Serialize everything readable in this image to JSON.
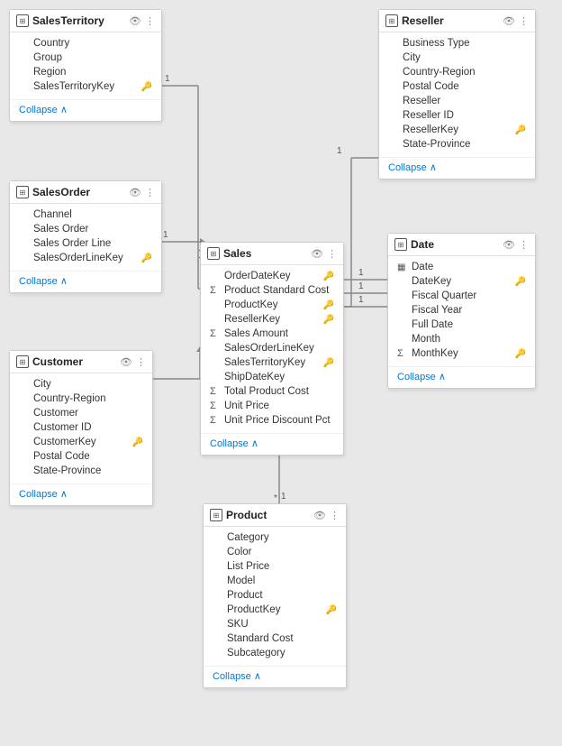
{
  "tables": {
    "salesTerritory": {
      "title": "SalesTerritory",
      "fields": [
        {
          "name": "Country",
          "prefix": "",
          "keyRight": false
        },
        {
          "name": "Group",
          "prefix": "",
          "keyRight": false
        },
        {
          "name": "Region",
          "prefix": "",
          "keyRight": false
        },
        {
          "name": "SalesTerritoryKey",
          "prefix": "",
          "keyRight": true
        }
      ],
      "collapse": "Collapse"
    },
    "reseller": {
      "title": "Reseller",
      "fields": [
        {
          "name": "Business Type",
          "prefix": "",
          "keyRight": false
        },
        {
          "name": "City",
          "prefix": "",
          "keyRight": false
        },
        {
          "name": "Country-Region",
          "prefix": "",
          "keyRight": false
        },
        {
          "name": "Postal Code",
          "prefix": "",
          "keyRight": false
        },
        {
          "name": "Reseller",
          "prefix": "",
          "keyRight": false
        },
        {
          "name": "Reseller ID",
          "prefix": "",
          "keyRight": false
        },
        {
          "name": "ResellerKey",
          "prefix": "",
          "keyRight": true
        },
        {
          "name": "State-Province",
          "prefix": "",
          "keyRight": false
        }
      ],
      "collapse": "Collapse"
    },
    "salesOrder": {
      "title": "SalesOrder",
      "fields": [
        {
          "name": "Channel",
          "prefix": "",
          "keyRight": false
        },
        {
          "name": "Sales Order",
          "prefix": "",
          "keyRight": false
        },
        {
          "name": "Sales Order Line",
          "prefix": "",
          "keyRight": false
        },
        {
          "name": "SalesOrderLineKey",
          "prefix": "",
          "keyRight": true
        }
      ],
      "collapse": "Collapse"
    },
    "sales": {
      "title": "Sales",
      "fields": [
        {
          "name": "OrderDateKey",
          "prefix": "",
          "keyRight": true
        },
        {
          "name": "Product Standard Cost",
          "prefix": "Σ",
          "keyRight": false
        },
        {
          "name": "ProductKey",
          "prefix": "",
          "keyRight": true
        },
        {
          "name": "ResellerKey",
          "prefix": "",
          "keyRight": true
        },
        {
          "name": "Sales Amount",
          "prefix": "Σ",
          "keyRight": false
        },
        {
          "name": "SalesOrderLineKey",
          "prefix": "",
          "keyRight": false
        },
        {
          "name": "SalesTerritoryKey",
          "prefix": "",
          "keyRight": true
        },
        {
          "name": "ShipDateKey",
          "prefix": "",
          "keyRight": false
        },
        {
          "name": "Total Product Cost",
          "prefix": "Σ",
          "keyRight": false
        },
        {
          "name": "Unit Price",
          "prefix": "Σ",
          "keyRight": false
        },
        {
          "name": "Unit Price Discount Pct",
          "prefix": "Σ",
          "keyRight": false
        }
      ],
      "collapse": "Collapse"
    },
    "date": {
      "title": "Date",
      "fields": [
        {
          "name": "Date",
          "prefix": "cal",
          "keyRight": false
        },
        {
          "name": "DateKey",
          "prefix": "",
          "keyRight": true
        },
        {
          "name": "Fiscal Quarter",
          "prefix": "",
          "keyRight": false
        },
        {
          "name": "Fiscal Year",
          "prefix": "",
          "keyRight": false
        },
        {
          "name": "Full Date",
          "prefix": "",
          "keyRight": false
        },
        {
          "name": "Month",
          "prefix": "",
          "keyRight": false
        },
        {
          "name": "MonthKey",
          "prefix": "Σ",
          "keyRight": true
        }
      ],
      "collapse": "Collapse"
    },
    "customer": {
      "title": "Customer",
      "fields": [
        {
          "name": "City",
          "prefix": "",
          "keyRight": false
        },
        {
          "name": "Country-Region",
          "prefix": "",
          "keyRight": false
        },
        {
          "name": "Customer",
          "prefix": "",
          "keyRight": false
        },
        {
          "name": "Customer ID",
          "prefix": "",
          "keyRight": false
        },
        {
          "name": "CustomerKey",
          "prefix": "",
          "keyRight": true
        },
        {
          "name": "Postal Code",
          "prefix": "",
          "keyRight": false
        },
        {
          "name": "State-Province",
          "prefix": "",
          "keyRight": false
        }
      ],
      "collapse": "Collapse"
    },
    "product": {
      "title": "Product",
      "fields": [
        {
          "name": "Category",
          "prefix": "",
          "keyRight": false
        },
        {
          "name": "Color",
          "prefix": "",
          "keyRight": false
        },
        {
          "name": "List Price",
          "prefix": "",
          "keyRight": false
        },
        {
          "name": "Model",
          "prefix": "",
          "keyRight": false
        },
        {
          "name": "Product",
          "prefix": "",
          "keyRight": false
        },
        {
          "name": "ProductKey",
          "prefix": "",
          "keyRight": true
        },
        {
          "name": "SKU",
          "prefix": "",
          "keyRight": false
        },
        {
          "name": "Standard Cost",
          "prefix": "",
          "keyRight": false
        },
        {
          "name": "Subcategory",
          "prefix": "",
          "keyRight": false
        }
      ],
      "collapse": "Collapse"
    }
  },
  "labels": {
    "collapse": "Collapse",
    "collapseArrow": "∧",
    "eyeIcon": "👁",
    "moreIcon": "⋮",
    "keyIcon": "🔑",
    "sumSymbol": "Σ",
    "calendarSymbol": "▦"
  }
}
